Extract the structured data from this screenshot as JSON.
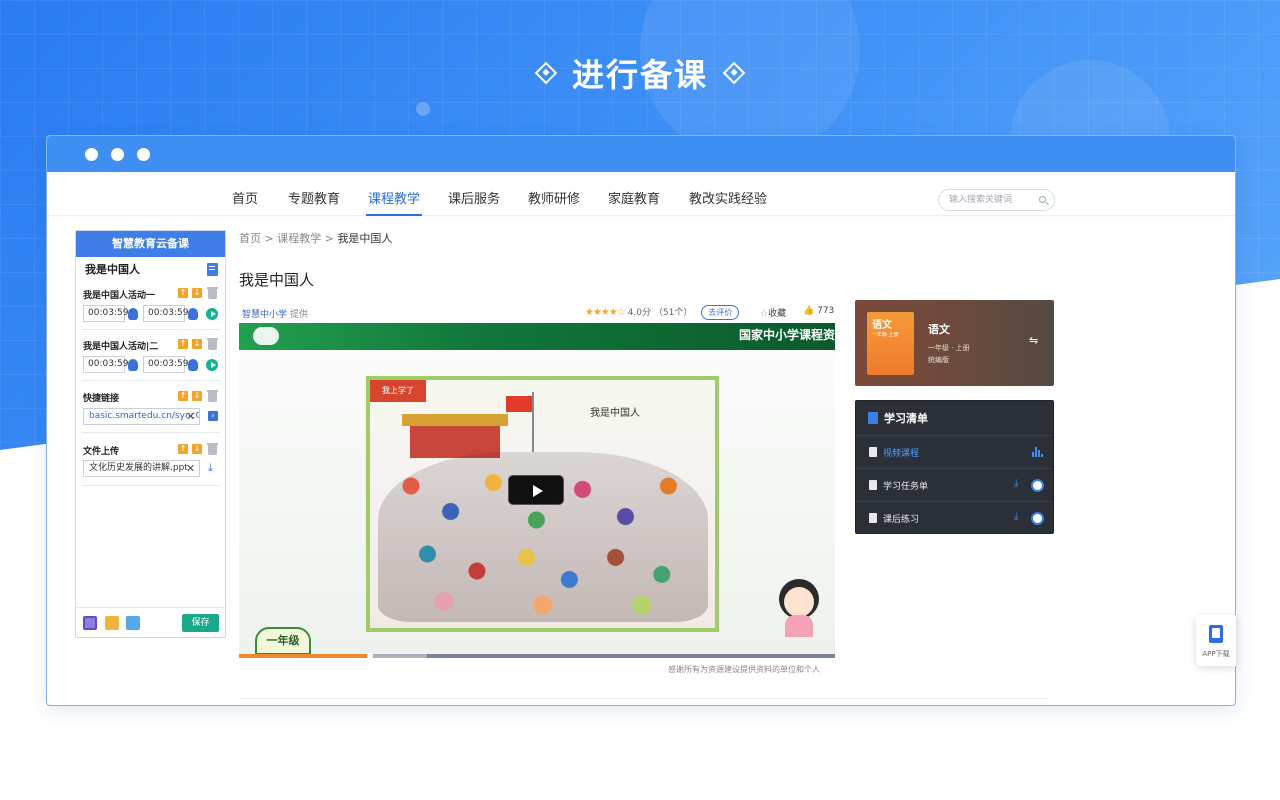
{
  "hero": {
    "title": "进行备课"
  },
  "nav": {
    "items": [
      "首页",
      "专题教育",
      "课程教学",
      "课后服务",
      "教师研修",
      "家庭教育",
      "教改实践经验"
    ],
    "active": "课程教学",
    "search_placeholder": "输入搜索关键词"
  },
  "left_panel": {
    "header": "智慧教育云备课",
    "lesson_title": "我是中国人",
    "activity1": {
      "title": "我是中国人活动一",
      "start": "00:03:59",
      "end": "00:03:59"
    },
    "activity2": {
      "title": "我是中国人活动|二",
      "start": "00:03:59",
      "end": "00:03:59"
    },
    "link": {
      "title": "快捷链接",
      "value": "basic.smartedu.cn/syncCl"
    },
    "upload": {
      "title": "文件上传",
      "file": "文化历史发展的讲解.ppt"
    },
    "save_label": "保存"
  },
  "main": {
    "breadcrumb": [
      "首页",
      "课程教学",
      "我是中国人"
    ],
    "title": "我是中国人",
    "provider": "智慧中小学",
    "provider_suffix": "提供",
    "rating_stars": "★★★★☆",
    "rating_score": "4.0分",
    "rating_count": "（51个）",
    "rate_button": "去评价",
    "favorite": "收藏",
    "likes": "773",
    "video_banner": "国家中小学课程资",
    "picture_tag": "我上学了",
    "picture_caption": "我是中国人",
    "grade_badge": "一年级",
    "video_progress": 0.22,
    "thanks": "感谢所有为资源建设提供资料的单位和个人"
  },
  "book": {
    "cover_title": "语文",
    "cover_sub": "一年级·上册",
    "name": "语文",
    "grade": "一年级 · 上册",
    "edition": "统编版"
  },
  "study_list": {
    "title": "学习清单",
    "items": [
      {
        "label": "视频课程",
        "active": true
      },
      {
        "label": "学习任务单",
        "active": false
      },
      {
        "label": "课后练习",
        "active": false
      }
    ]
  },
  "app_download": {
    "label": "APP下载"
  },
  "colors": {
    "primary": "#3e7ee6",
    "save": "#19a889",
    "accent_orange": "#f2a32a"
  }
}
